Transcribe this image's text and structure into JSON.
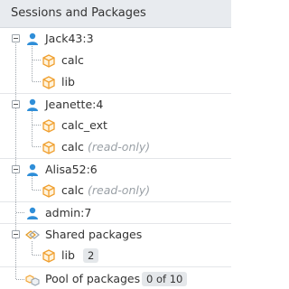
{
  "panel": {
    "title": "Sessions and Packages"
  },
  "sessions": [
    {
      "name": "Jack43:3",
      "packages": [
        {
          "name": "calc"
        },
        {
          "name": "lib"
        }
      ]
    },
    {
      "name": "Jeanette:4",
      "packages": [
        {
          "name": "calc_ext"
        },
        {
          "name": "calc",
          "note": "(read-only)"
        }
      ]
    },
    {
      "name": "Alisa52:6",
      "packages": [
        {
          "name": "calc",
          "note": "(read-only)"
        }
      ]
    },
    {
      "name": "admin:7"
    }
  ],
  "shared": {
    "label": "Shared packages",
    "packages": [
      {
        "name": "lib",
        "count": "2"
      }
    ]
  },
  "pool": {
    "label": "Pool of packages",
    "count": "0 of 10"
  },
  "colors": {
    "user_icon": "#2f8ed8",
    "package_icon": "#f0a030",
    "shared_icon": "#e09a28"
  }
}
